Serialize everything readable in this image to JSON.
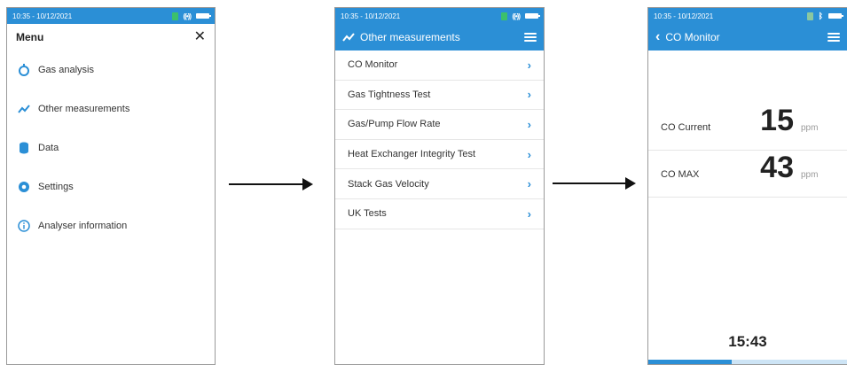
{
  "status": {
    "time": "10:35 - 10/12/2021"
  },
  "screen1": {
    "title": "Menu",
    "close": "✕",
    "items": [
      {
        "label": "Gas analysis"
      },
      {
        "label": "Other measurements"
      },
      {
        "label": "Data"
      },
      {
        "label": "Settings"
      },
      {
        "label": "Analyser information"
      }
    ]
  },
  "screen2": {
    "title": "Other measurements",
    "items": [
      {
        "label": "CO Monitor"
      },
      {
        "label": "Gas Tightness Test"
      },
      {
        "label": "Gas/Pump Flow Rate"
      },
      {
        "label": "Heat Exchanger Integrity Test"
      },
      {
        "label": "Stack Gas Velocity"
      },
      {
        "label": "UK Tests"
      }
    ]
  },
  "screen3": {
    "back": "‹",
    "title": "CO Monitor",
    "readings": [
      {
        "label": "CO Current",
        "value": "15",
        "unit": "ppm"
      },
      {
        "label": "CO MAX",
        "value": "43",
        "unit": "ppm"
      }
    ],
    "timer": "15:43",
    "progress": 0.42
  },
  "colors": {
    "accent": "#2b8fd6"
  },
  "icons": [
    "gas-analysis-icon",
    "chart-line-icon",
    "database-icon",
    "gear-icon",
    "info-icon",
    "chevron-right-icon",
    "hamburger-icon",
    "battery-icon",
    "sim-icon",
    "bluetooth-icon",
    "radio-icon"
  ]
}
